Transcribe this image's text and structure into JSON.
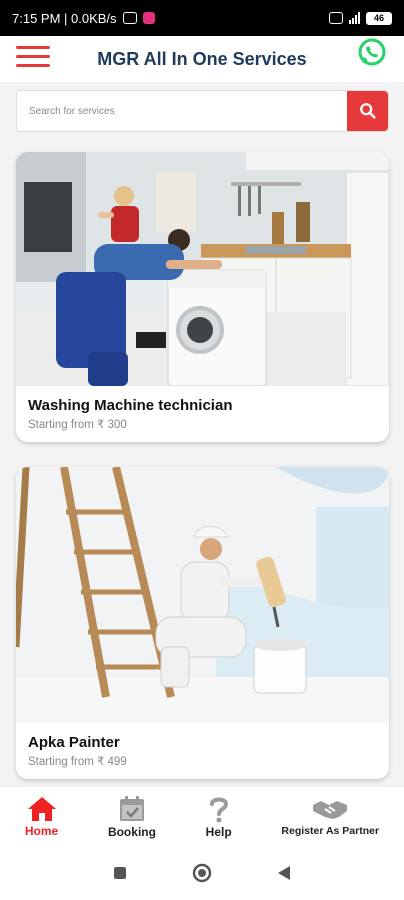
{
  "status_bar": {
    "time_and_speed": "7:15 PM | 0.0KB/s",
    "battery": "46"
  },
  "header": {
    "title": "MGR All In One Services"
  },
  "search": {
    "placeholder": "Search for services"
  },
  "services": [
    {
      "title": "Washing Machine technician",
      "price": "Starting from ₹ 300"
    },
    {
      "title": "Apka Painter",
      "price": "Starting from ₹ 499"
    }
  ],
  "bottom_nav": {
    "items": [
      {
        "label": "Home",
        "icon": "home-icon"
      },
      {
        "label": "Booking",
        "icon": "calendar-icon"
      },
      {
        "label": "Help",
        "icon": "question-icon"
      },
      {
        "label": "Register As Partner",
        "icon": "handshake-icon"
      }
    ]
  },
  "colors": {
    "accent": "#e63a3a",
    "title": "#1f3a5a",
    "whatsapp": "#25d366"
  }
}
